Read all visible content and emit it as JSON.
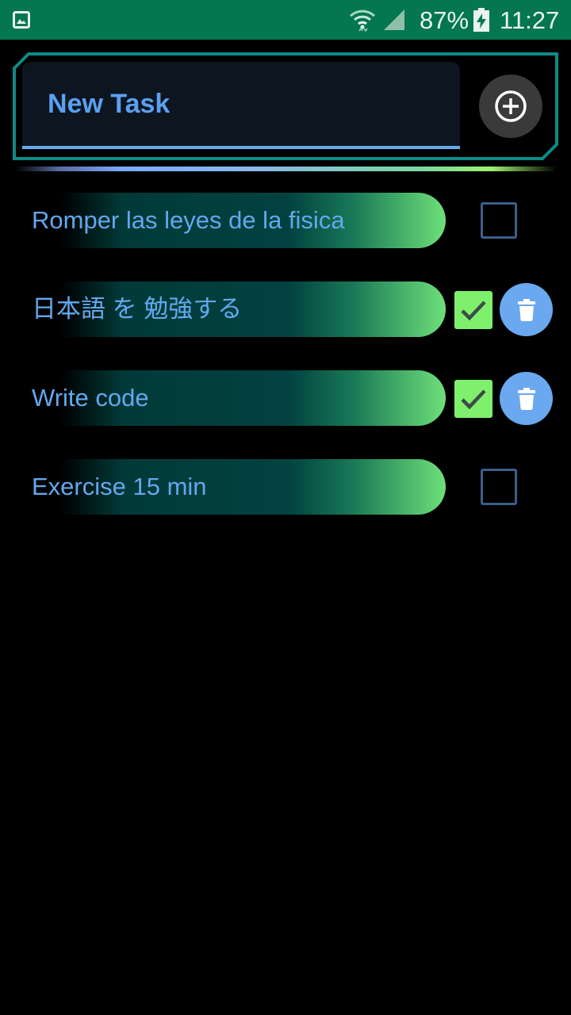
{
  "status_bar": {
    "battery_percent": "87%",
    "time": "11:27",
    "icons": [
      "gallery-icon",
      "wifi-icon",
      "signal-icon",
      "battery-charging-icon"
    ]
  },
  "new_task": {
    "placeholder": "New Task",
    "value": "",
    "add_icon": "add-circle-icon"
  },
  "colors": {
    "status_bar_bg": "#047650",
    "accent_blue": "#6aa8f0",
    "accent_green": "#7ef06c",
    "frame_teal": "#0d8a86"
  },
  "tasks": [
    {
      "text": "Romper las leyes de la fisica",
      "completed": false
    },
    {
      "text": "日本語 を 勉強する",
      "completed": true
    },
    {
      "text": "Write code",
      "completed": true
    },
    {
      "text": "Exercise 15 min",
      "completed": false
    }
  ]
}
